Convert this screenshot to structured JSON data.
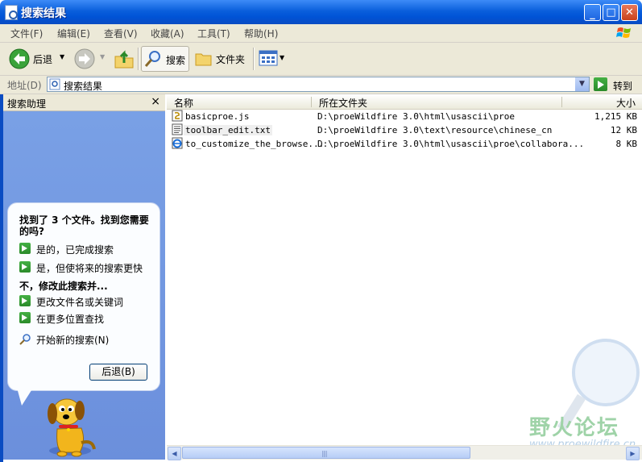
{
  "window": {
    "title": "搜索结果"
  },
  "menu": [
    "文件(F)",
    "编辑(E)",
    "查看(V)",
    "收藏(A)",
    "工具(T)",
    "帮助(H)"
  ],
  "toolbar": {
    "back_label": "后退",
    "search_label": "搜索",
    "folders_label": "文件夹"
  },
  "address": {
    "label": "地址(D)",
    "value": "搜索结果",
    "go_label": "转到"
  },
  "assistant": {
    "title": "搜索助理",
    "close": "×",
    "question": "找到了 3 个文件。找到您需要的吗?",
    "opt_done": "是的，已完成搜索",
    "opt_faster": "是，但使将来的搜索更快",
    "refine_heading": "不，修改此搜索并...",
    "opt_rename": "更改文件名或关键词",
    "opt_more_locations": "在更多位置查找",
    "opt_new_search": "开始新的搜索(N)",
    "back_button": "后退(B)"
  },
  "results": {
    "columns": {
      "name": "名称",
      "folder": "所在文件夹",
      "size": "大小"
    },
    "rows": [
      {
        "name": "basicproe.js",
        "folder": "D:\\proeWildfire 3.0\\html\\usascii\\proe",
        "size": "1,215 KB",
        "icon": "script-file-icon"
      },
      {
        "name": "toolbar_edit.txt",
        "folder": "D:\\proeWildfire 3.0\\text\\resource\\chinese_cn",
        "size": "12 KB",
        "icon": "text-file-icon"
      },
      {
        "name": "to_customize_the_browse...",
        "folder": "D:\\proeWildfire 3.0\\html\\usascii\\proe\\collabora...",
        "size": "8 KB",
        "icon": "html-file-icon"
      }
    ]
  },
  "watermark": {
    "text": "野火论坛",
    "url": "www.proewildfire.cn"
  }
}
